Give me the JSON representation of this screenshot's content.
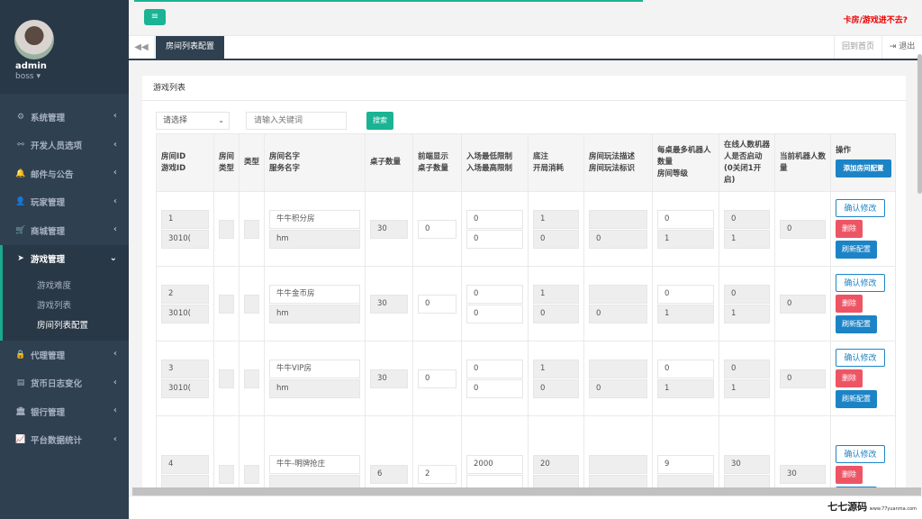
{
  "user": {
    "name": "admin",
    "role": "boss ▾"
  },
  "menu": [
    {
      "icon": "⚙",
      "label": "系统管理",
      "arrow": "‹"
    },
    {
      "icon": "⚯",
      "label": "开发人员选项",
      "arrow": "‹"
    },
    {
      "icon": "🔔",
      "label": "邮件与公告",
      "arrow": "‹"
    },
    {
      "icon": "👤",
      "label": "玩家管理",
      "arrow": "‹"
    },
    {
      "icon": "🛒",
      "label": "商城管理",
      "arrow": "‹"
    },
    {
      "icon": "➤",
      "label": "游戏管理",
      "arrow": "⌄"
    },
    {
      "icon": "🔒",
      "label": "代理管理",
      "arrow": "‹"
    },
    {
      "icon": "▤",
      "label": "货币日志变化",
      "arrow": "‹"
    },
    {
      "icon": "🏛",
      "label": "银行管理",
      "arrow": "‹"
    },
    {
      "icon": "📈",
      "label": "平台数据统计",
      "arrow": "‹"
    }
  ],
  "submenu": [
    "游戏难度",
    "游戏列表",
    "房间列表配置"
  ],
  "topbar": {
    "menu_icon": "≡",
    "warning": "卡房/游戏进不去?"
  },
  "tabs": {
    "back_icon": "◀◀",
    "active": "房间列表配置",
    "home": "回到首页",
    "logout": "⇥ 退出"
  },
  "panel": {
    "title": "游戏列表"
  },
  "filter": {
    "select": "请选择",
    "keyword_placeholder": "请输入关键词",
    "search": "搜索"
  },
  "table": {
    "headers": [
      "房间ID\n游戏ID",
      "房间类型",
      "类型",
      "房间名字\n服务名字",
      "桌子数量",
      "前端显示\n桌子数量",
      "入场最低限制\n入场最高限制",
      "底注\n开局消耗",
      "房间玩法描述\n房间玩法标识",
      "每桌最多机器人数量\n房间等级",
      "在线人数机器人是否启动(0关闭1开启)",
      "当前机器人数量",
      "操作"
    ],
    "add_button": "添加房间配置",
    "rows": [
      {
        "room_id": "1",
        "game_id": "3010(",
        "room_name": "牛牛积分房",
        "server": "hm",
        "tables": "30",
        "front_tables": "0",
        "min": "0",
        "max": "0",
        "base": "1",
        "cost": "0",
        "desc": "",
        "mark": "0",
        "robots": "0",
        "level": "1",
        "online": "0",
        "robot_on": "1",
        "cur_robots": "0"
      },
      {
        "room_id": "2",
        "game_id": "3010(",
        "room_name": "牛牛金币房",
        "server": "hm",
        "tables": "30",
        "front_tables": "0",
        "min": "0",
        "max": "0",
        "base": "1",
        "cost": "0",
        "desc": "",
        "mark": "0",
        "robots": "0",
        "level": "1",
        "online": "0",
        "robot_on": "1",
        "cur_robots": "0"
      },
      {
        "room_id": "3",
        "game_id": "3010(",
        "room_name": "牛牛VIP房",
        "server": "hm",
        "tables": "30",
        "front_tables": "0",
        "min": "0",
        "max": "0",
        "base": "1",
        "cost": "0",
        "desc": "",
        "mark": "0",
        "robots": "0",
        "level": "1",
        "online": "0",
        "robot_on": "1",
        "cur_robots": "0"
      },
      {
        "room_id": "4",
        "game_id": "",
        "room_name": "牛牛-明牌抢庄",
        "server": "",
        "tables": "6",
        "front_tables": "2",
        "min": "2000",
        "max": "",
        "base": "20",
        "cost": "",
        "desc": "",
        "mark": "",
        "robots": "9",
        "level": "",
        "online": "30",
        "robot_on": "",
        "cur_robots": "30"
      }
    ],
    "actions": {
      "confirm": "确认修改",
      "delete": "删除",
      "refresh": "刷新配置"
    }
  },
  "watermark": {
    "logo": "七七源码",
    "tagline": "www.77yuanma.com"
  }
}
